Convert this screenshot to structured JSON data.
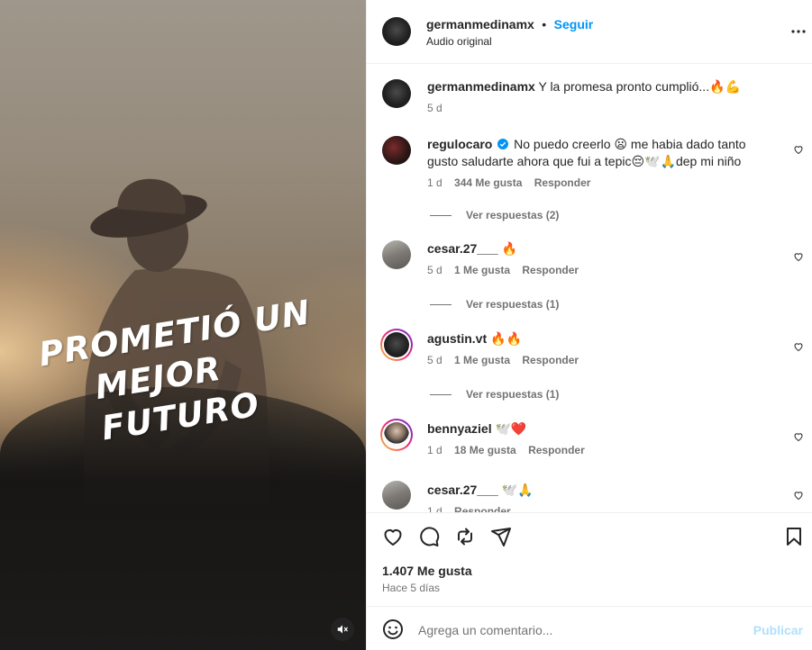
{
  "media": {
    "overlay_line1": "PROMETIÓ UN",
    "overlay_line2": "MEJOR FUTURO",
    "mute_icon": "speaker-muted-icon"
  },
  "header": {
    "username": "germanmedinamx",
    "separator": "•",
    "follow_label": "Seguir",
    "subtitle": "Audio original",
    "more_icon": "more-horizontal-icon"
  },
  "caption": {
    "username": "germanmedinamx",
    "text": "Y la promesa pronto cumplió...🔥💪",
    "time": "5 d"
  },
  "comments": [
    {
      "username": "regulocaro",
      "verified": true,
      "text": "No puedo creerlo 😦 me habia dado tanto gusto saludarte ahora que fui a tepic😔🕊️🙏dep mi niño",
      "time": "1 d",
      "likes": "344 Me gusta",
      "reply": "Responder",
      "view_replies": "Ver respuestas (2)"
    },
    {
      "username": "cesar.27___",
      "text": "🔥",
      "time": "5 d",
      "likes": "1 Me gusta",
      "reply": "Responder",
      "view_replies": "Ver respuestas (1)"
    },
    {
      "username": "agustin.vt",
      "text": "🔥🔥",
      "time": "5 d",
      "likes": "1 Me gusta",
      "reply": "Responder",
      "view_replies": "Ver respuestas (1)"
    },
    {
      "username": "bennyaziel",
      "text": "🕊️❤️",
      "time": "1 d",
      "likes": "18 Me gusta",
      "reply": "Responder"
    },
    {
      "username": "cesar.27___",
      "text": "🕊️🙏",
      "time": "1 d",
      "reply": "Responder"
    }
  ],
  "actions": {
    "like_icon": "heart-icon",
    "comment_icon": "comment-icon",
    "share_icon": "repost-icon",
    "send_icon": "send-icon",
    "save_icon": "bookmark-icon",
    "likes_count": "1.407 Me gusta",
    "posted": "Hace 5 días"
  },
  "add_comment": {
    "emoji_icon": "smiley-icon",
    "placeholder": "Agrega un comentario...",
    "publish_label": "Publicar"
  },
  "colors": {
    "accent": "#0095f6",
    "muted": "#737373",
    "text": "#262626",
    "publish_disabled": "#b2dffc"
  }
}
